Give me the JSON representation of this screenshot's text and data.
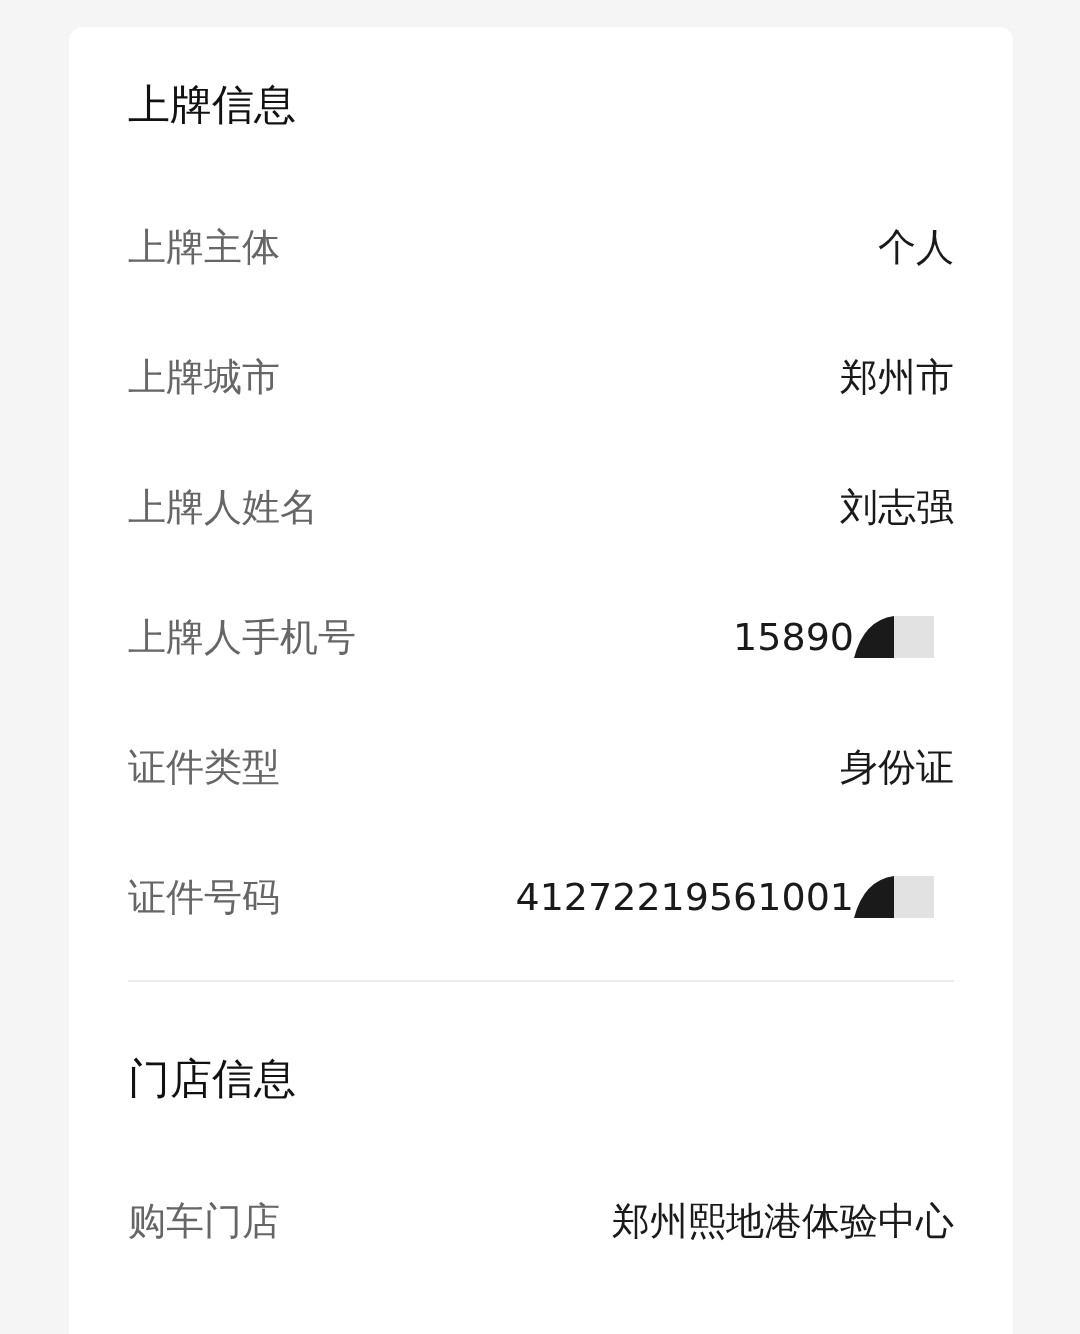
{
  "sections": [
    {
      "title": "上牌信息",
      "rows": [
        {
          "label": "上牌主体",
          "value": "个人",
          "redacted": false
        },
        {
          "label": "上牌城市",
          "value": "郑州市",
          "redacted": false
        },
        {
          "label": "上牌人姓名",
          "value": "刘志强",
          "redacted": false
        },
        {
          "label": "上牌人手机号",
          "value": "15890",
          "redacted": true
        },
        {
          "label": "证件类型",
          "value": "身份证",
          "redacted": false
        },
        {
          "label": "证件号码",
          "value": "41272219561001",
          "redacted": true
        }
      ]
    },
    {
      "title": "门店信息",
      "rows": [
        {
          "label": "购车门店",
          "value": "郑州熙地港体验中心",
          "redacted": false
        }
      ]
    }
  ]
}
